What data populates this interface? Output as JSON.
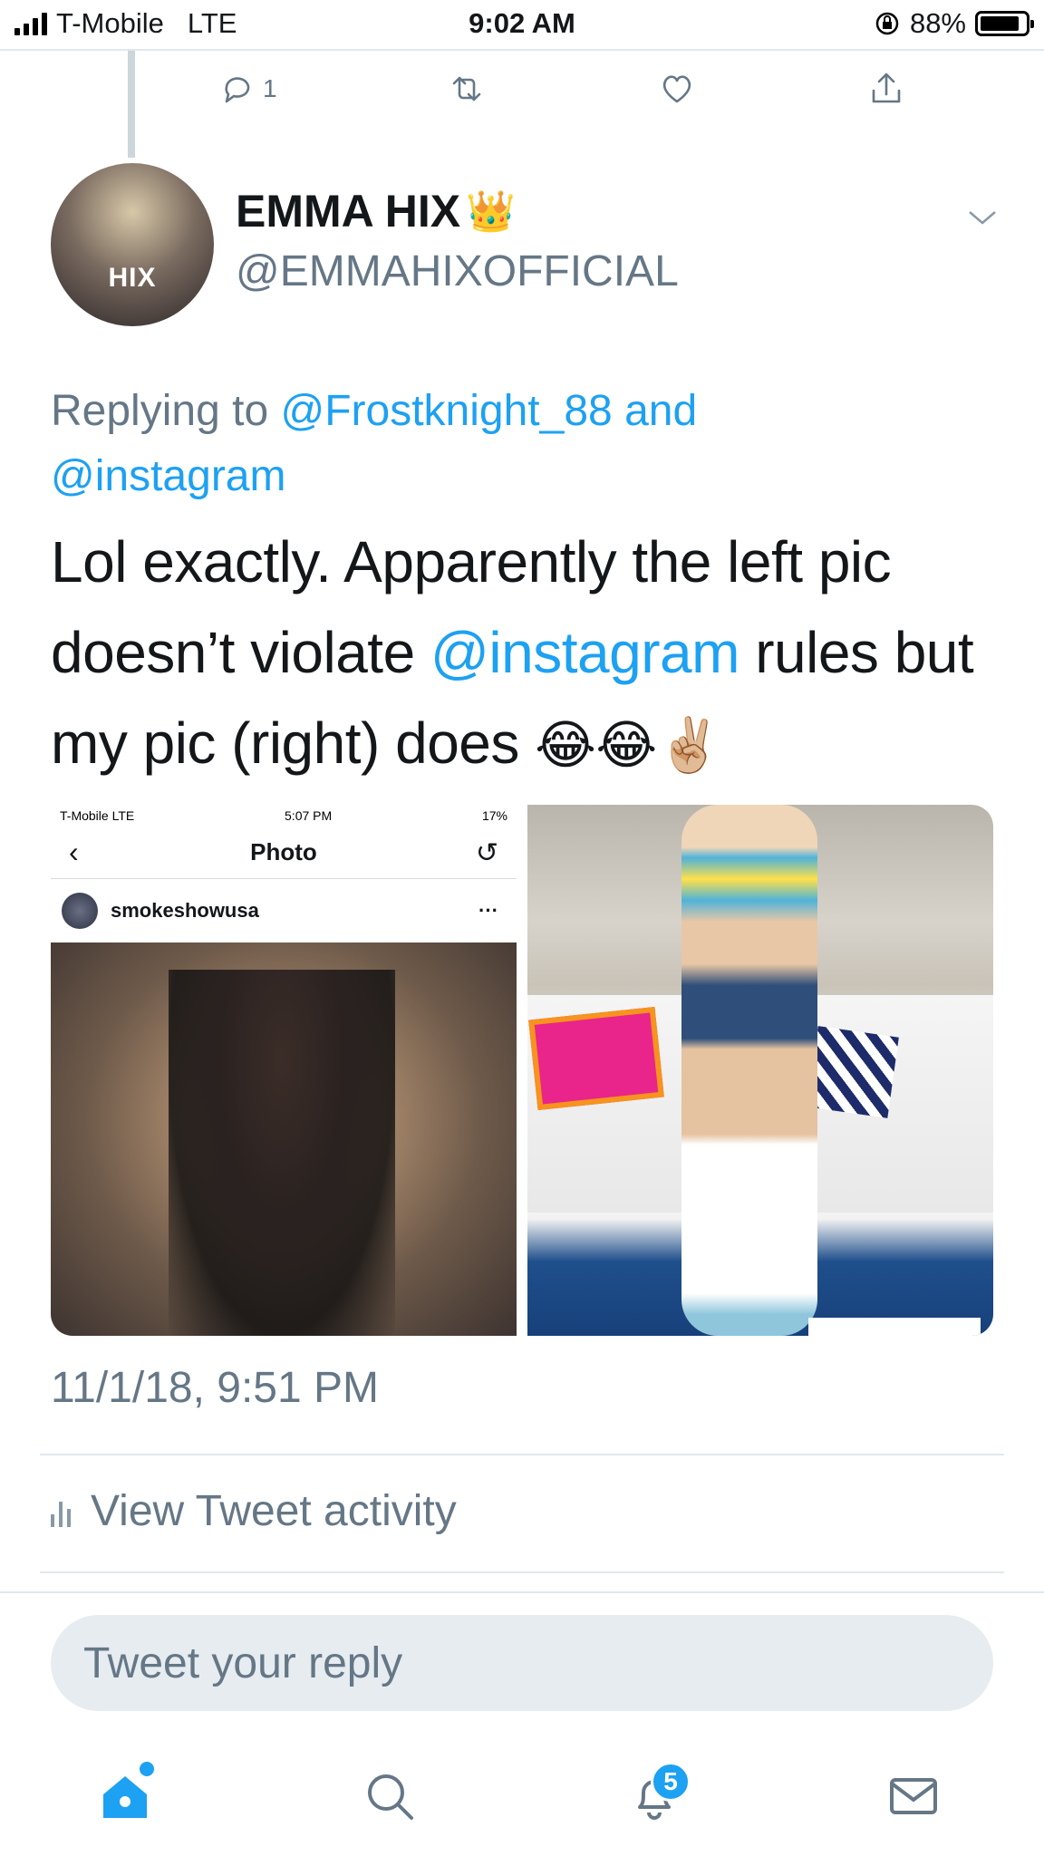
{
  "status_bar": {
    "carrier": "T-Mobile",
    "network": "LTE",
    "time": "9:02 AM",
    "battery_percent": "88%",
    "battery_level": 0.88
  },
  "previous_tweet_actions": {
    "reply_count": "1"
  },
  "tweet": {
    "display_name": "EMMA HIX",
    "display_name_emoji": "👑",
    "handle": "@EMMAHIXOFFICIAL",
    "avatar_text": "HIX",
    "replying_prefix": "Replying to",
    "replying_user1": "@Frostknight_88",
    "replying_and": "and",
    "replying_user2": "@instagram",
    "text_part1": "Lol exactly. Apparently the left pic doesn’t violate",
    "text_mention": "@instagram",
    "text_part2": "rules but my pic (right) does",
    "text_emojis": "😂😂✌🏼",
    "timestamp": "11/1/18, 9:51 PM",
    "view_activity": "View Tweet activity"
  },
  "media_left": {
    "status_carrier": "T-Mobile  LTE",
    "status_time": "5:07 PM",
    "status_battery": "17%",
    "nav_title": "Photo",
    "username": "smokeshowusa",
    "more": "···"
  },
  "reply": {
    "placeholder": "Tweet your reply"
  },
  "tab_bar": {
    "notifications_badge": "5"
  },
  "colors": {
    "accent": "#1da1f2",
    "secondary_text": "#657786",
    "primary_text": "#14171a"
  }
}
